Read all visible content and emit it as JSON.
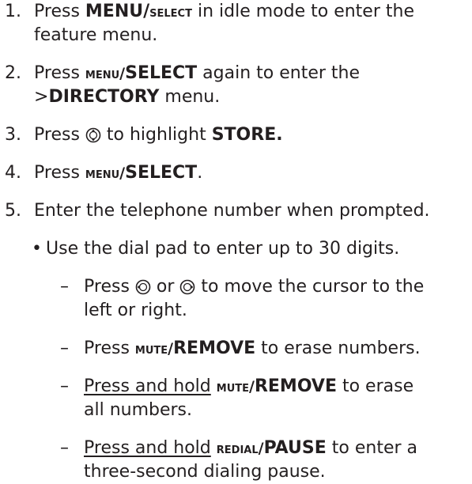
{
  "steps": [
    {
      "num": "1.",
      "pre": "Press ",
      "kw1": "MENU/",
      "kw2": "select",
      "post": " in idle mode to enter the",
      "line2": "feature menu."
    },
    {
      "num": "2.",
      "pre": "Press ",
      "kw1": "menu/",
      "kw2": "SELECT",
      "post": " again to enter the",
      "line2_pre": ">",
      "line2_kw": "DIRECTORY",
      "line2_post": " menu."
    },
    {
      "num": "3.",
      "pre": "Press ",
      "post": " to highlight ",
      "kw": "STORE."
    },
    {
      "num": "4.",
      "pre": "Press ",
      "kw1": "menu/",
      "kw2": "SELECT",
      "post": "."
    },
    {
      "num": "5.",
      "text": "Enter the telephone number when prompted."
    }
  ],
  "bullet": {
    "symbol": "•",
    "text": "Use the dial pad to enter up to 30 digits."
  },
  "subs": [
    {
      "dash": "–",
      "pre": "Press ",
      "mid": " or ",
      "post": " to move the cursor to the",
      "line2": "left or right."
    },
    {
      "dash": "–",
      "pre": "Press ",
      "kw1": "mute/",
      "kw2": "REMOVE",
      "post": " to erase numbers."
    },
    {
      "dash": "–",
      "u": "Press and hold",
      "kw1": "mute/",
      "kw2": "REMOVE",
      "post": " to erase",
      "line2": "all numbers."
    },
    {
      "dash": "–",
      "u": "Press and hold",
      "kw1": "redial/",
      "kw2": "PAUSE",
      "post": " to enter a",
      "line2": "three-second dialing pause."
    }
  ],
  "icons": {
    "step3": "scroll-up-down-key-icon",
    "sub1_a": "left-arrow-key-icon",
    "sub1_b": "right-arrow-key-icon"
  }
}
